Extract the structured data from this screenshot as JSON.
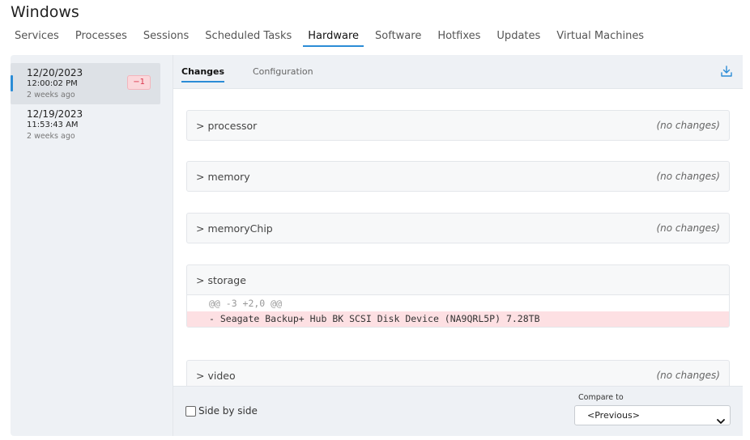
{
  "window": {
    "title": "Windows"
  },
  "tabs": [
    {
      "label": "Services"
    },
    {
      "label": "Processes"
    },
    {
      "label": "Sessions"
    },
    {
      "label": "Scheduled Tasks"
    },
    {
      "label": "Hardware",
      "active": true
    },
    {
      "label": "Software"
    },
    {
      "label": "Hotfixes"
    },
    {
      "label": "Updates"
    },
    {
      "label": "Virtual Machines"
    }
  ],
  "snapshots": [
    {
      "date": "12/20/2023",
      "time": "12:00:02 PM",
      "ago": "2 weeks ago",
      "badge": "−1",
      "active": true
    },
    {
      "date": "12/19/2023",
      "time": "11:53:43 AM",
      "ago": "2 weeks ago"
    }
  ],
  "subtabs": {
    "changes": "Changes",
    "configuration": "Configuration"
  },
  "sections": [
    {
      "name": "> processor",
      "status": "(no changes)"
    },
    {
      "name": "> memory",
      "status": "(no changes)"
    },
    {
      "name": "> memoryChip",
      "status": "(no changes)"
    },
    {
      "name": "> storage",
      "status": "",
      "diff": {
        "hunk": "@@ -3 +2,0 @@",
        "removed": "- Seagate Backup+ Hub BK SCSI Disk Device (NA9QRL5P) 7.28TB"
      }
    },
    {
      "name": "> video",
      "status": "(no changes)"
    }
  ],
  "footer": {
    "side_by_side_label": "Side by side",
    "compare_to_label": "Compare to",
    "compare_to_value": "<Previous>"
  },
  "colors": {
    "accent": "#2b8cd6",
    "removed_bg": "#fde0e3",
    "badge_text": "#d9324a"
  }
}
